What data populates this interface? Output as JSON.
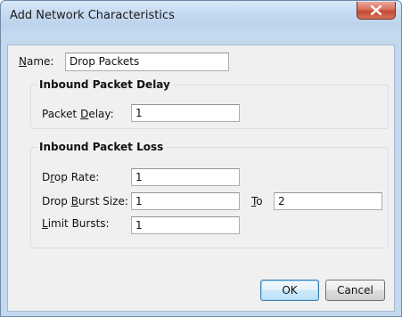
{
  "window": {
    "title": "Add Network Characteristics",
    "close_icon": "close-x-icon"
  },
  "name_field": {
    "label_mnemonic": "N",
    "label_rest": "ame:",
    "value": "Drop Packets"
  },
  "inbound_packet_delay": {
    "title": "Inbound Packet Delay",
    "packet_delay": {
      "label_before": "Packet ",
      "label_mnemonic": "D",
      "label_after": "elay:",
      "value": "1"
    }
  },
  "inbound_packet_loss": {
    "title": "Inbound Packet Loss",
    "drop_rate": {
      "label_before": "D",
      "label_mnemonic": "r",
      "label_after": "op Rate:",
      "value": "1"
    },
    "drop_burst_size": {
      "label_before": "Drop ",
      "label_mnemonic": "B",
      "label_after": "urst Size:",
      "value": "1"
    },
    "to": {
      "label_mnemonic": "T",
      "label_after": "o",
      "value": "2"
    },
    "limit_bursts": {
      "label_mnemonic": "L",
      "label_after": "imit Bursts:",
      "value": "1"
    }
  },
  "buttons": {
    "ok_label": "OK",
    "cancel_label": "Cancel"
  },
  "colors": {
    "title_bar": "#c6dbf1",
    "close_button": "#c34a34",
    "dialog_background": "#f0f0f0",
    "default_button_border": "#3c7fb1"
  }
}
